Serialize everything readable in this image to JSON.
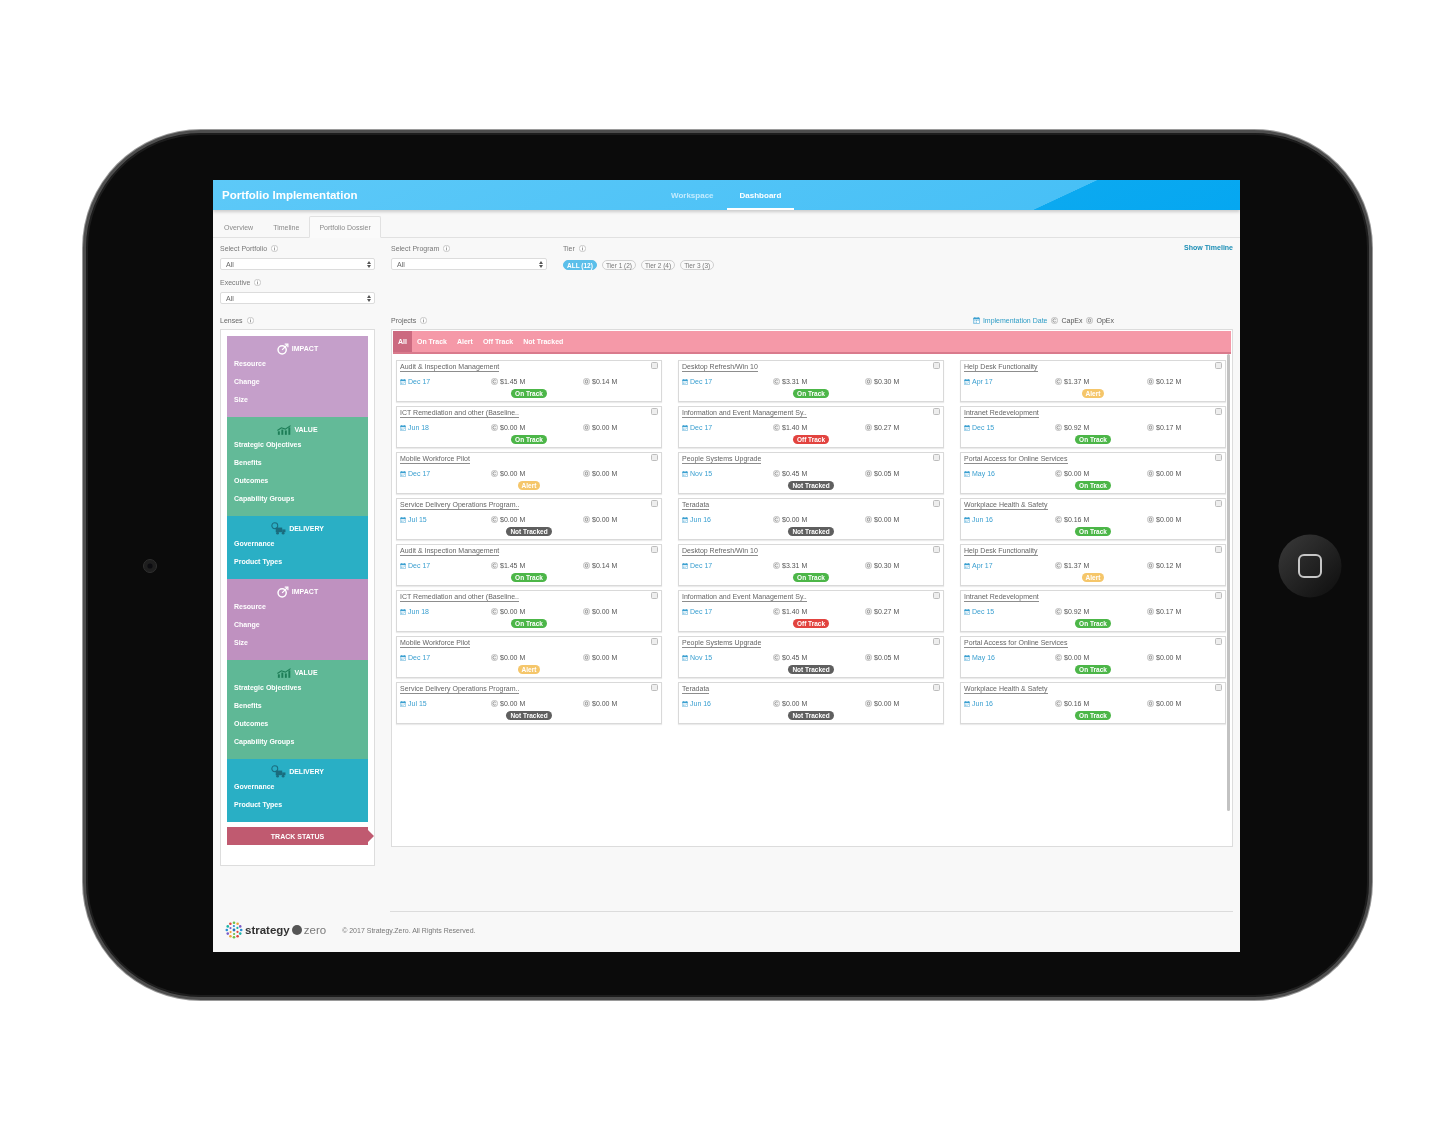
{
  "header": {
    "title": "Portfolio Implementation",
    "nav": [
      {
        "label": "Workspace",
        "selected": false
      },
      {
        "label": "Dashboard",
        "selected": true
      }
    ]
  },
  "tabs": [
    {
      "label": "Overview",
      "selected": false
    },
    {
      "label": "Timeline",
      "selected": false
    },
    {
      "label": "Portfolio Dossier",
      "selected": true
    }
  ],
  "filters": {
    "portfolio": {
      "label": "Select Portfolio",
      "value": "All"
    },
    "executive": {
      "label": "Executive",
      "value": "All"
    },
    "program": {
      "label": "Select Program",
      "value": "All"
    },
    "tier": {
      "label": "Tier",
      "options": [
        {
          "label": "ALL (12)",
          "selected": true
        },
        {
          "label": "Tier 1 (2)",
          "selected": false
        },
        {
          "label": "Tier 2 (4)",
          "selected": false
        },
        {
          "label": "Tier 3 (3)",
          "selected": false
        }
      ]
    },
    "show_timeline": "Show Timeline"
  },
  "lenses": {
    "title": "Lenses",
    "sections": [
      {
        "kind": "impact",
        "title": "IMPACT",
        "color": "#c59fca",
        "items": [
          "Resource",
          "Change",
          "Size"
        ]
      },
      {
        "kind": "value",
        "title": "VALUE",
        "color": "#63ba98",
        "items": [
          "Strategic Objectives",
          "Benefits",
          "Outcomes",
          "Capability Groups"
        ]
      },
      {
        "kind": "delivery",
        "title": "DELIVERY",
        "color": "#2aafc5",
        "items": [
          "Governance",
          "Product Types"
        ]
      },
      {
        "kind": "impact",
        "title": "IMPACT",
        "color": "#bf91c0",
        "items": [
          "Resource",
          "Change",
          "Size"
        ]
      },
      {
        "kind": "value",
        "title": "VALUE",
        "color": "#5fb896",
        "items": [
          "Strategic Objectives",
          "Benefits",
          "Outcomes",
          "Capability Groups"
        ]
      },
      {
        "kind": "delivery",
        "title": "DELIVERY",
        "color": "#29afc5",
        "items": [
          "Governance",
          "Product Types"
        ]
      }
    ],
    "track_status": "TRACK STATUS"
  },
  "projects": {
    "title": "Projects",
    "legend": {
      "date": "Implementation Date",
      "capex": "CapEx",
      "opex": "OpEx"
    },
    "status_filters": [
      {
        "label": "All",
        "selected": true
      },
      {
        "label": "On Track",
        "selected": false
      },
      {
        "label": "Alert",
        "selected": false
      },
      {
        "label": "Off Track",
        "selected": false
      },
      {
        "label": "Not Tracked",
        "selected": false
      }
    ],
    "cards": [
      {
        "title": "Audit & Inspection Management",
        "date": "Dec 17",
        "capex": "$1.45 M",
        "opex": "$0.14 M",
        "checked": false,
        "status": {
          "label": "On Track",
          "color": "#4cb648"
        }
      },
      {
        "title": "Desktop Refresh/Win 10",
        "date": "Dec 17",
        "capex": "$3.31 M",
        "opex": "$0.30 M",
        "checked": false,
        "status": {
          "label": "On Track",
          "color": "#4cb648"
        }
      },
      {
        "title": "Help Desk Functionality",
        "date": "Apr 17",
        "capex": "$1.37 M",
        "opex": "$0.12 M",
        "checked": false,
        "status": {
          "label": "Alert",
          "color": "#f5c66a"
        }
      },
      {
        "title": "ICT Remediation and other (Baseline..",
        "date": "Jun 18",
        "capex": "$0.00 M",
        "opex": "$0.00 M",
        "checked": false,
        "status": {
          "label": "On Track",
          "color": "#4cb648"
        }
      },
      {
        "title": "Information and Event Management Sy..",
        "date": "Dec 17",
        "capex": "$1.40 M",
        "opex": "$0.27 M",
        "checked": false,
        "status": {
          "label": "Off Track",
          "color": "#e2433f"
        }
      },
      {
        "title": "Intranet Redevelopment",
        "date": "Dec 15",
        "capex": "$0.92 M",
        "opex": "$0.17 M",
        "checked": false,
        "status": {
          "label": "On Track",
          "color": "#4cb648"
        }
      },
      {
        "title": "Mobile Workforce Pilot",
        "date": "Dec 17",
        "capex": "$0.00 M",
        "opex": "$0.00 M",
        "checked": false,
        "status": {
          "label": "Alert",
          "color": "#f5c66a"
        }
      },
      {
        "title": "People Systems Upgrade",
        "date": "Nov 15",
        "capex": "$0.45 M",
        "opex": "$0.05 M",
        "checked": false,
        "status": {
          "label": "Not Tracked",
          "color": "#5f5f5f"
        }
      },
      {
        "title": "Portal Access for Online Services",
        "date": "May 16",
        "capex": "$0.00 M",
        "opex": "$0.00 M",
        "checked": false,
        "status": {
          "label": "On Track",
          "color": "#4cb648"
        }
      },
      {
        "title": "Service Delivery Operations Program..",
        "date": "Jul 15",
        "capex": "$0.00 M",
        "opex": "$0.00 M",
        "checked": false,
        "status": {
          "label": "Not Tracked",
          "color": "#5f5f5f"
        }
      },
      {
        "title": "Teradata",
        "date": "Jun 16",
        "capex": "$0.00 M",
        "opex": "$0.00 M",
        "checked": false,
        "status": {
          "label": "Not Tracked",
          "color": "#5f5f5f"
        }
      },
      {
        "title": "Workplace Health & Safety",
        "date": "Jun 16",
        "capex": "$0.16 M",
        "opex": "$0.00 M",
        "checked": false,
        "status": {
          "label": "On Track",
          "color": "#4cb648"
        }
      },
      {
        "title": "Audit & Inspection Management",
        "date": "Dec 17",
        "capex": "$1.45 M",
        "opex": "$0.14 M",
        "checked": false,
        "status": {
          "label": "On Track",
          "color": "#4cb648"
        }
      },
      {
        "title": "Desktop Refresh/Win 10",
        "date": "Dec 17",
        "capex": "$3.31 M",
        "opex": "$0.30 M",
        "checked": false,
        "status": {
          "label": "On Track",
          "color": "#4cb648"
        }
      },
      {
        "title": "Help Desk Functionality",
        "date": "Apr 17",
        "capex": "$1.37 M",
        "opex": "$0.12 M",
        "checked": false,
        "status": {
          "label": "Alert",
          "color": "#f5c66a"
        }
      },
      {
        "title": "ICT Remediation and other (Baseline..",
        "date": "Jun 18",
        "capex": "$0.00 M",
        "opex": "$0.00 M",
        "checked": false,
        "status": {
          "label": "On Track",
          "color": "#4cb648"
        }
      },
      {
        "title": "Information and Event Management Sy..",
        "date": "Dec 17",
        "capex": "$1.40 M",
        "opex": "$0.27 M",
        "checked": false,
        "status": {
          "label": "Off Track",
          "color": "#e2433f"
        }
      },
      {
        "title": "Intranet Redevelopment",
        "date": "Dec 15",
        "capex": "$0.92 M",
        "opex": "$0.17 M",
        "checked": false,
        "status": {
          "label": "On Track",
          "color": "#4cb648"
        }
      },
      {
        "title": "Mobile Workforce Pilot",
        "date": "Dec 17",
        "capex": "$0.00 M",
        "opex": "$0.00 M",
        "checked": false,
        "status": {
          "label": "Alert",
          "color": "#f5c66a"
        }
      },
      {
        "title": "People Systems Upgrade",
        "date": "Nov 15",
        "capex": "$0.45 M",
        "opex": "$0.05 M",
        "checked": false,
        "status": {
          "label": "Not Tracked",
          "color": "#5f5f5f"
        }
      },
      {
        "title": "Portal Access for Online Services",
        "date": "May 16",
        "capex": "$0.00 M",
        "opex": "$0.00 M",
        "checked": false,
        "status": {
          "label": "On Track",
          "color": "#4cb648"
        }
      },
      {
        "title": "Service Delivery Operations Program..",
        "date": "Jul 15",
        "capex": "$0.00 M",
        "opex": "$0.00 M",
        "checked": false,
        "status": {
          "label": "Not Tracked",
          "color": "#5f5f5f"
        }
      },
      {
        "title": "Teradata",
        "date": "Jun 16",
        "capex": "$0.00 M",
        "opex": "$0.00 M",
        "checked": false,
        "status": {
          "label": "Not Tracked",
          "color": "#5f5f5f"
        }
      },
      {
        "title": "Workplace Health & Safety",
        "date": "Jun 16",
        "capex": "$0.16 M",
        "opex": "$0.00 M",
        "checked": false,
        "status": {
          "label": "On Track",
          "color": "#4cb648"
        }
      }
    ]
  },
  "footer": {
    "logo": {
      "name": "strategy",
      "suffix": "zero"
    },
    "copyright": "© 2017 Strategy.Zero. All Rights Reserved."
  }
}
